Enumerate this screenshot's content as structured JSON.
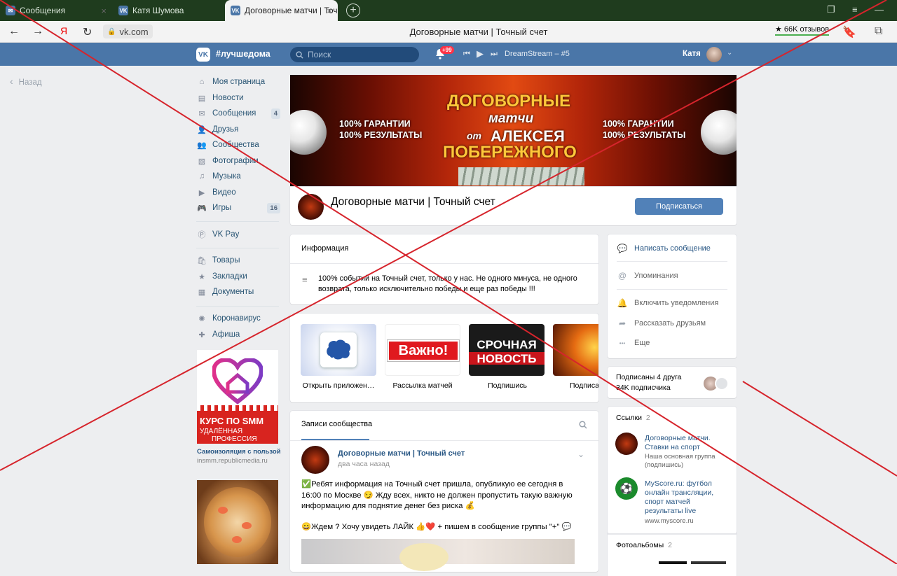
{
  "browser": {
    "tabs": [
      {
        "label": "Сообщения",
        "active": false
      },
      {
        "label": "Катя Шумова",
        "active": false
      },
      {
        "label": "Договорные матчи | Точ",
        "active": true
      }
    ],
    "url": "vk.com",
    "page_title": "Договорные матчи | Точный счет",
    "reviews": "★ 66K отзывов"
  },
  "header": {
    "hashtag": "#лучшедома",
    "search_placeholder": "Поиск",
    "notifications": "+99",
    "track": "DreamStream – #5",
    "user_name": "Катя"
  },
  "left": {
    "back": "Назад",
    "items": [
      {
        "label": "Моя страница",
        "icon": "home-icon"
      },
      {
        "label": "Новости",
        "icon": "news-icon"
      },
      {
        "label": "Сообщения",
        "icon": "messages-icon",
        "count": "4"
      },
      {
        "label": "Друзья",
        "icon": "friends-icon"
      },
      {
        "label": "Сообщества",
        "icon": "communities-icon"
      },
      {
        "label": "Фотографии",
        "icon": "photos-icon"
      },
      {
        "label": "Музыка",
        "icon": "music-icon"
      },
      {
        "label": "Видео",
        "icon": "video-icon"
      },
      {
        "label": "Игры",
        "icon": "games-icon",
        "count": "16"
      },
      {
        "label": "VK Pay",
        "icon": "vkpay-icon"
      },
      {
        "label": "Товары",
        "icon": "goods-icon"
      },
      {
        "label": "Закладки",
        "icon": "bookmarks-icon"
      },
      {
        "label": "Документы",
        "icon": "documents-icon"
      },
      {
        "label": "Коронавирус",
        "icon": "virus-icon"
      },
      {
        "label": "Афиша",
        "icon": "afisha-icon"
      }
    ],
    "ad": {
      "line1": "КУРС ПО SMM",
      "line2": "УДАЛЁННАЯ",
      "line3": "ПРОФЕССИЯ",
      "caption": "Самоизоляция с пользой",
      "url": "insmm.republicmedia.ru"
    }
  },
  "cover": {
    "title1": "ДОГОВОРНЫЕ",
    "title2": "матчи",
    "title3": "от",
    "title4": "АЛЕКСЕЯ",
    "title5": "ПОБЕРЕЖНОГО",
    "guarantee": "100% ГАРАНТИИ",
    "results": "100% РЕЗУЛЬТАТЫ"
  },
  "group": {
    "name": "Договорные матчи | Точный счет",
    "subscribe": "Подписаться"
  },
  "info": {
    "title": "Информация",
    "text": "100% событий на Точный счет, только у нас. Не одного минуса, не одного возврата, только исключительно победы и еще раз победы !!!"
  },
  "apps": [
    {
      "label": "Открыть приложен…"
    },
    {
      "label": "Рассылка матчей",
      "img_text": "Важно!"
    },
    {
      "label": "Подпишись",
      "img_text1": "СРОЧНАЯ",
      "img_text2": "НОВОСТЬ"
    },
    {
      "label": "Подписа"
    }
  ],
  "wall": {
    "tab": "Записи сообщества",
    "post_author": "Договорные матчи | Точный счет",
    "post_time": "два часа назад",
    "post_text1": "✅Ребят информация на Точный счет пришла, опубликую ее сегодня в 16:00 по Москве 😏 Жду всех, никто не должен пропустить такую важную информацию для поднятие денег без риска 💰",
    "post_text2": "😄Ждем ? Хочу увидеть ЛАЙК 👍❤️ + пишем в сообщение группы \"+\" 💬"
  },
  "actions": [
    {
      "label": "Написать сообщение",
      "icon": "message-icon"
    },
    {
      "label": "Упоминания",
      "icon": "at-icon"
    },
    {
      "label": "Включить уведомления",
      "icon": "bell-icon"
    },
    {
      "label": "Рассказать друзьям",
      "icon": "share-icon"
    },
    {
      "label": "Еще",
      "icon": "more-icon"
    }
  ],
  "followers": {
    "friends": "Подписаны 4 друга",
    "count": "34K подписчика"
  },
  "links": {
    "title": "Ссылки",
    "count": "2",
    "items": [
      {
        "name": "Договорные матчи. Ставки на спорт",
        "desc": "Наша основная группа (подпишись)"
      },
      {
        "name": "MyScore.ru: футбол онлайн трансляции, спорт матчей результаты live",
        "desc": "www.myscore.ru"
      }
    ]
  },
  "albums": {
    "title": "Фотоальбомы",
    "count": "2"
  },
  "colors": {
    "vk_blue": "#4a76a8",
    "button": "#5181b8",
    "cross": "#d6242c"
  }
}
